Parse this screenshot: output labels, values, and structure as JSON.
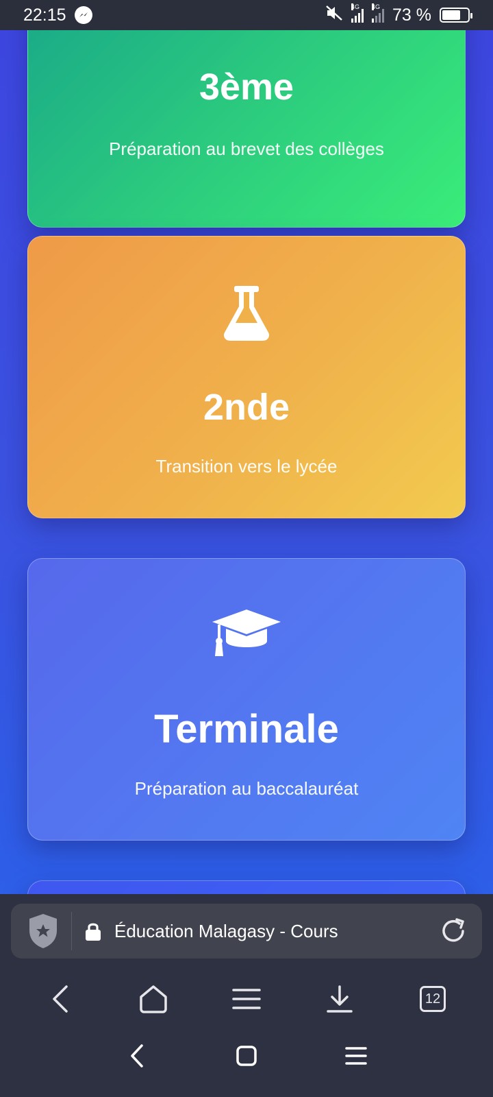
{
  "status_bar": {
    "time": "22:15",
    "network_1": "4G",
    "network_2": "4G",
    "battery_percent": "73 %",
    "battery_level": 0.73,
    "icons": [
      "messenger-icon",
      "mute-icon",
      "signal-icon",
      "signal-icon",
      "battery-icon"
    ]
  },
  "cards": [
    {
      "title": "3ème",
      "subtitle": "Préparation au brevet des collèges",
      "gradient": [
        "#17a38a",
        "#3aed79"
      ]
    },
    {
      "title": "2nde",
      "subtitle": "Transition vers le lycée",
      "icon": "flask-icon",
      "gradient": [
        "#ef9a48",
        "#f2cb4f"
      ]
    },
    {
      "title": "Terminale",
      "subtitle": "Préparation au baccalauréat",
      "icon": "graduation-cap-icon",
      "gradient": [
        "#5668ec",
        "#4f84f4"
      ]
    }
  ],
  "browser": {
    "page_title": "Éducation Malagasy - Cours",
    "tab_count": "12",
    "icons": [
      "shield-icon",
      "lock-icon",
      "reload-icon",
      "back-icon",
      "home-icon",
      "menu-icon",
      "download-icon",
      "tabs-icon"
    ]
  },
  "system_nav": {
    "icons": [
      "system-back-icon",
      "system-home-icon",
      "system-recents-icon"
    ]
  },
  "colors": {
    "background_top": "#3d47e0",
    "background_bottom": "#2d5fe8",
    "browser_chrome": "#2e3142",
    "url_bar": "#41444f"
  }
}
